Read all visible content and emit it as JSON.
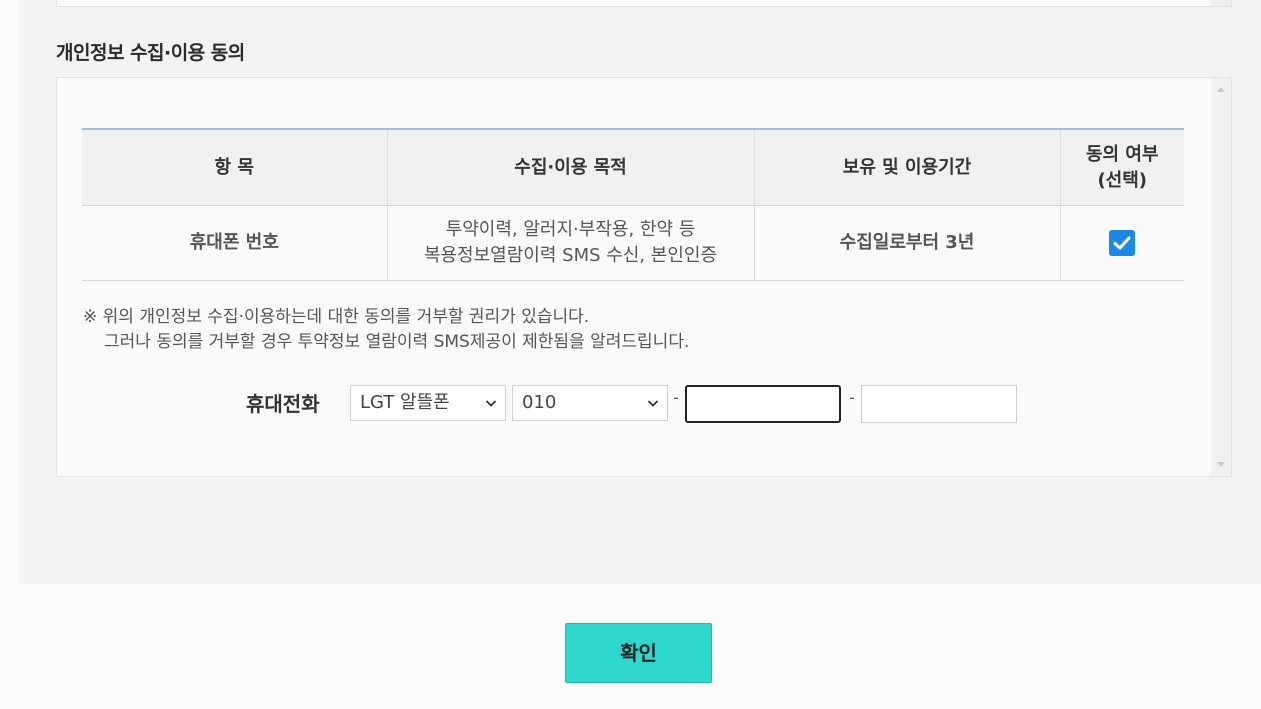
{
  "section_title": "개인정보 수집·이용 동의",
  "table": {
    "headers": {
      "item": "항 목",
      "purpose": "수집·이용 목적",
      "period": "보유 및 이용기간",
      "consent_line1": "동의 여부",
      "consent_line2": "(선택)"
    },
    "row": {
      "item": "휴대폰 번호",
      "purpose_line1": "투약이력, 알러지·부작용, 한약 등",
      "purpose_line2": "복용정보열람이력 SMS 수신, 본인인증",
      "period": "수집일로부터 3년",
      "consent_checked": true
    }
  },
  "notice": {
    "line1": "※ 위의 개인정보 수집·이용하는데 대한 동의를 거부할 권리가 있습니다.",
    "line2": "그러나 동의를 거부할 경우 투약정보 열람이력 SMS제공이 제한됨을 알려드립니다."
  },
  "phone": {
    "label": "휴대전화",
    "carrier": "LGT 알뜰폰",
    "prefix": "010",
    "separator": "-",
    "middle_value": "",
    "last_value": ""
  },
  "confirm_label": "확인",
  "colors": {
    "accent": "#2ed8cc",
    "checkbox": "#1e88e5",
    "table_top_border": "#9bbfdc"
  },
  "icons": [
    "checkmark-icon",
    "chevron-down-icon",
    "scroll-up-arrow-icon",
    "scroll-down-arrow-icon"
  ]
}
